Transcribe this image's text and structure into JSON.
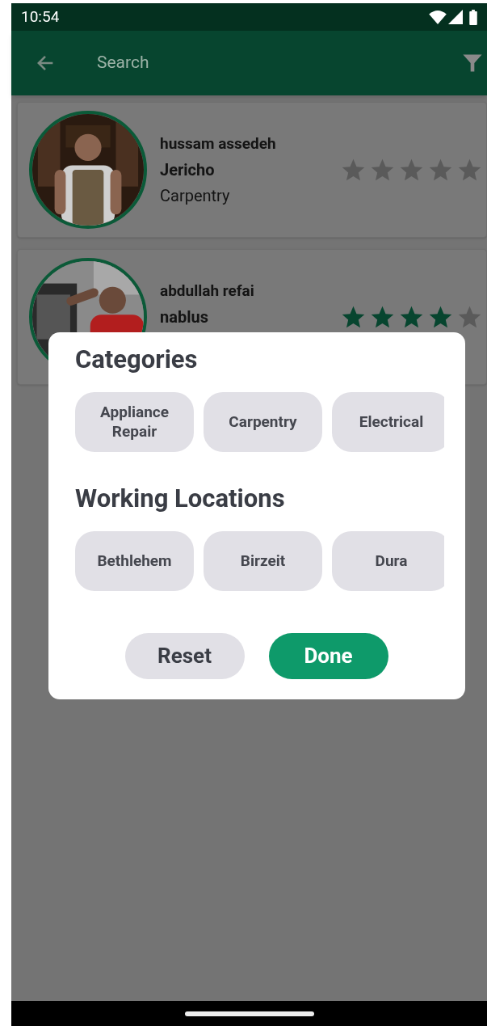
{
  "status_bar": {
    "time": "10:54"
  },
  "app_bar": {
    "search_placeholder": "Search"
  },
  "workers": [
    {
      "name": "hussam assedeh",
      "city": "Jericho",
      "category": "Carpentry",
      "stars": 0
    },
    {
      "name": "abdullah refai",
      "city": "nablus",
      "stars": 4
    }
  ],
  "filter_dialog": {
    "sections": [
      {
        "title": "Categories",
        "chips": [
          {
            "label": "Appliance Repair",
            "selected": false
          },
          {
            "label": "Carpentry",
            "selected": false
          },
          {
            "label": "Electrical",
            "selected": false
          }
        ]
      },
      {
        "title": "Working Locations",
        "chips": [
          {
            "label": "Bethlehem",
            "selected": false
          },
          {
            "label": "Birzeit",
            "selected": false
          },
          {
            "label": "Dura",
            "selected": false
          }
        ]
      }
    ],
    "buttons": [
      {
        "label": "Reset",
        "kind": "secondary"
      },
      {
        "label": "Done",
        "kind": "primary"
      }
    ]
  }
}
